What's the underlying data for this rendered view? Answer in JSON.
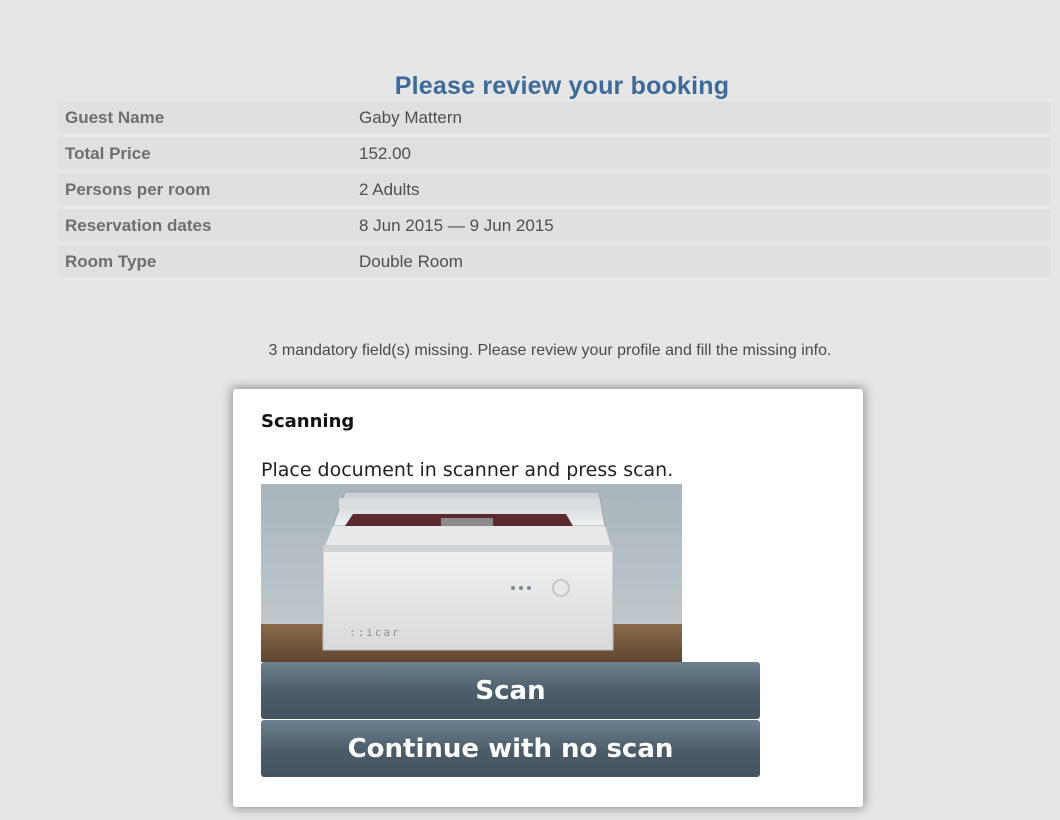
{
  "review": {
    "title": "Please review your booking",
    "rows": [
      {
        "label": "Guest Name",
        "value": "Gaby Mattern"
      },
      {
        "label": "Total Price",
        "value": "152.00"
      },
      {
        "label": "Persons per room",
        "value": "2 Adults"
      },
      {
        "label": "Reservation dates",
        "value": "8 Jun 2015 — 9 Jun 2015"
      },
      {
        "label": "Room Type",
        "value": "Double Room"
      }
    ]
  },
  "missing_message": "3 mandatory field(s) missing. Please review your profile and fill the missing info.",
  "dialog": {
    "title": "Scanning",
    "message": "Place document in scanner and press scan.",
    "scanner_brand": "::icar",
    "scan_label": "Scan",
    "continue_label": "Continue with no scan"
  },
  "colors": {
    "background": "#e6e6e6",
    "title_blue": "#3c6a9a",
    "button": "#4b5c69"
  }
}
